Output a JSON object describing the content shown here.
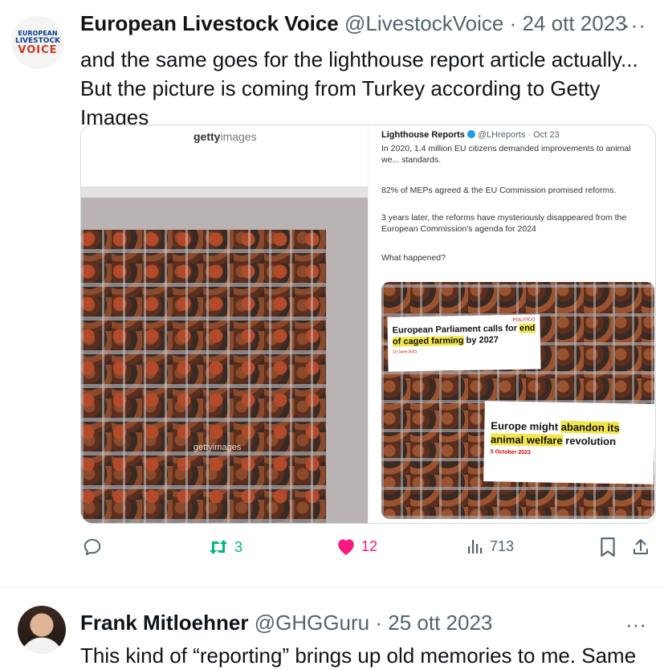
{
  "tweet1": {
    "avatar": {
      "line1": "EUROPEAN",
      "line2": "LIVESTOCK",
      "line3": "VOICE"
    },
    "display_name": "European Livestock Voice",
    "handle": "@LivestockVoice",
    "separator": "·",
    "date": "24 ott 2023",
    "more_label": "···",
    "text": "and the same goes for the lighthouse report article actually... But the picture is coming from Turkey according to Getty Images",
    "media": {
      "left": {
        "logo_bold": "getty",
        "logo_rest": "images",
        "watermark": "gettyimages"
      },
      "right": {
        "name": "Lighthouse Reports",
        "handle": "@LHreports",
        "separator": "·",
        "date": "Oct 23",
        "p1": "In 2020, 1.4 million EU citizens demanded improvements to animal we... standards.",
        "p2": "82% of MEPs agreed & the EU Commission promised reforms.",
        "p3": "3 years later, the reforms have mysteriously disappeared from the European Commission's agenda for 2024",
        "p4": "What happened?",
        "clip1": {
          "source": "POLITICO",
          "h_a": "European Parliament calls for ",
          "h_mark": "end of caged farming",
          "h_b": " by 2027",
          "date": "10 June 2021"
        },
        "clip2": {
          "h_a": "Europe might ",
          "h_mark1": "abandon its",
          "h_mark2": "animal welfare",
          "h_b": " revolution",
          "date": "5 October 2023"
        }
      }
    },
    "actions": {
      "replies": "",
      "reposts": "3",
      "likes": "12",
      "views": "713"
    },
    "colors": {
      "repost": "#00ba7c",
      "like": "#f91880",
      "muted": "#536471"
    }
  },
  "tweet2": {
    "display_name": "Frank Mitloehner",
    "handle": "@GHGGuru",
    "separator": "·",
    "date": "25 ott 2023",
    "more_label": "···",
    "text": "This kind of “reporting” brings up old memories to me. Same"
  }
}
